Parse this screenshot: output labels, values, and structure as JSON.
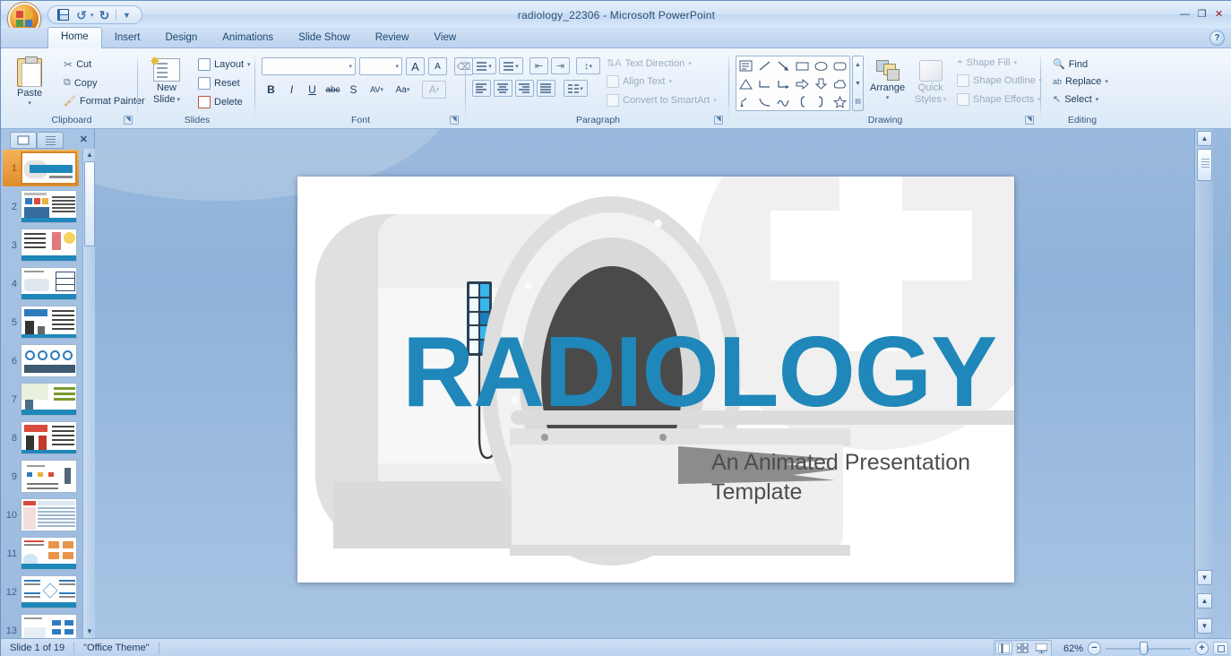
{
  "window": {
    "title": "radiology_22306 - Microsoft PowerPoint",
    "minimize": "—",
    "maximize": "❐",
    "close": "✕"
  },
  "quick_access": {
    "office_button": "office-orb",
    "save_label": "Save",
    "undo_label": "Undo",
    "redo_label": "Redo",
    "customize_label": "Customize Quick Access Toolbar"
  },
  "ribbon": {
    "help_label": "?",
    "tabs": [
      {
        "label": "Home",
        "active": true
      },
      {
        "label": "Insert",
        "active": false
      },
      {
        "label": "Design",
        "active": false
      },
      {
        "label": "Animations",
        "active": false
      },
      {
        "label": "Slide Show",
        "active": false
      },
      {
        "label": "Review",
        "active": false
      },
      {
        "label": "View",
        "active": false
      }
    ],
    "groups": {
      "clipboard": {
        "label": "Clipboard",
        "paste": "Paste",
        "cut": "Cut",
        "copy": "Copy",
        "format_painter": "Format Painter"
      },
      "slides": {
        "label": "Slides",
        "new_slide_line1": "New",
        "new_slide_line2": "Slide",
        "layout": "Layout",
        "reset": "Reset",
        "delete": "Delete"
      },
      "font": {
        "label": "Font",
        "font_name_value": "",
        "font_size_value": "",
        "grow_font": "A",
        "shrink_font": "A",
        "clear_formatting": "Clear All Formatting",
        "bold": "B",
        "italic": "I",
        "underline": "U",
        "strikethrough": "abc",
        "shadow": "S",
        "character_spacing": "AV",
        "change_case": "Aa",
        "font_color": "A"
      },
      "paragraph": {
        "label": "Paragraph",
        "bullets": "Bullets",
        "numbering": "Numbering",
        "decrease_indent": "Decrease List Level",
        "increase_indent": "Increase List Level",
        "line_spacing": "Line Spacing",
        "align_left": "Align Text Left",
        "align_center": "Center",
        "align_right": "Align Text Right",
        "justify": "Justify",
        "columns": "Columns",
        "text_direction": "Text Direction",
        "align_text": "Align Text",
        "convert_to_smartart": "Convert to SmartArt"
      },
      "drawing": {
        "label": "Drawing",
        "arrange": "Arrange",
        "quick_styles_line1": "Quick",
        "quick_styles_line2": "Styles",
        "shape_fill": "Shape Fill",
        "shape_outline": "Shape Outline",
        "shape_effects": "Shape Effects",
        "shapes": [
          "text-box-icon",
          "line-icon",
          "arrow-icon",
          "rectangle-icon",
          "oval-icon",
          "rounded-rectangle-icon",
          "triangle-icon",
          "elbow-connector-icon",
          "elbow-arrow-connector-icon",
          "right-arrow-icon",
          "down-arrow-icon",
          "cloud-icon",
          "freeform-icon",
          "curve-icon",
          "scribble-icon",
          "left-brace-icon",
          "right-brace-icon",
          "star-icon"
        ]
      },
      "editing": {
        "label": "Editing",
        "find": "Find",
        "replace": "Replace",
        "select": "Select"
      }
    }
  },
  "slides_pane": {
    "tab_slides": "Slides",
    "tab_outline": "Outline",
    "close": "✕",
    "thumbnails": [
      {
        "number": "1",
        "selected": true
      },
      {
        "number": "2",
        "selected": false
      },
      {
        "number": "3",
        "selected": false
      },
      {
        "number": "4",
        "selected": false
      },
      {
        "number": "5",
        "selected": false
      },
      {
        "number": "6",
        "selected": false
      },
      {
        "number": "7",
        "selected": false
      },
      {
        "number": "8",
        "selected": false
      },
      {
        "number": "9",
        "selected": false
      },
      {
        "number": "10",
        "selected": false
      },
      {
        "number": "11",
        "selected": false
      },
      {
        "number": "12",
        "selected": false
      },
      {
        "number": "13",
        "selected": false
      }
    ]
  },
  "slide": {
    "title": "RADIOLOGY",
    "subtitle": "An Animated Presentation Template",
    "title_color": "#1f87b9",
    "subtitle_color": "#4d4d4d",
    "artwork": "ct-scanner-illustration"
  },
  "status_bar": {
    "slide_count": "Slide 1 of 19",
    "theme": "\"Office Theme\"",
    "zoom": "62%",
    "zoom_out": "−",
    "zoom_in": "+",
    "view_normal": "Normal View",
    "view_sorter": "Slide Sorter",
    "view_show": "Slide Show",
    "fit_to_window": "Fit slide to current window"
  }
}
